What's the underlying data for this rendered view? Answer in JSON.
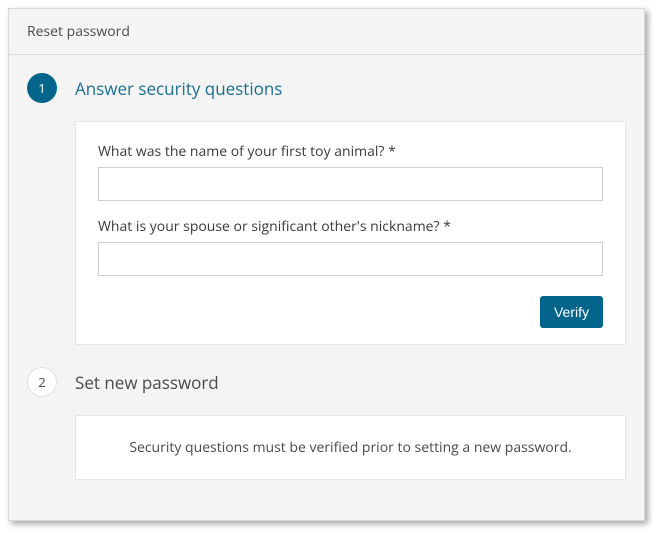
{
  "header": {
    "title": "Reset password"
  },
  "steps": {
    "security": {
      "number": "1",
      "title": "Answer security questions",
      "q1_label": "What was the name of your first toy animal? *",
      "q1_value": "",
      "q2_label": "What is your spouse or significant other's nickname? *",
      "q2_value": "",
      "verify_label": "Verify"
    },
    "newpassword": {
      "number": "2",
      "title": "Set new password",
      "message": "Security questions must be verified prior to setting a new password."
    }
  }
}
